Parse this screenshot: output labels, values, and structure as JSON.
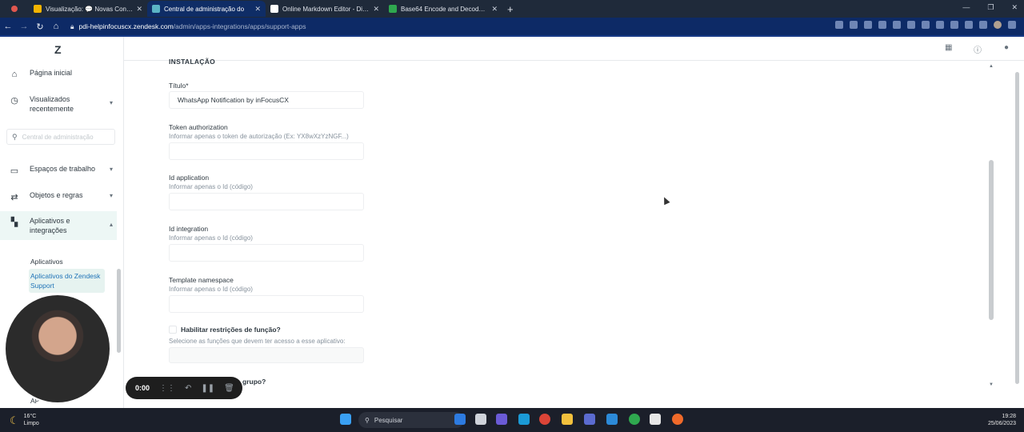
{
  "browser": {
    "tabs": [
      {
        "label": "Visualização: 💬 Novas Conversa",
        "color": "#f4b400",
        "active": false
      },
      {
        "label": "Central de administração do",
        "color": "#5ab4c5",
        "active": true
      },
      {
        "label": "Online Markdown Editor - Dilling",
        "color": "#ffffff",
        "active": false
      },
      {
        "label": "Base64 Encode and Decode - On",
        "color": "#2fa84f",
        "active": false
      }
    ],
    "url_host": "pdi-helpinfocuscx.zendesk.com",
    "url_path": "/admin/apps-integrations/apps/support-apps"
  },
  "sidebar": {
    "items": [
      {
        "label": "Página inicial",
        "icon": "home-icon"
      },
      {
        "label": "Visualizados recentemente",
        "icon": "clock-icon"
      },
      {
        "label": "Espaços de trabalho",
        "icon": "monitor-icon"
      },
      {
        "label": "Objetos e regras",
        "icon": "rules-icon"
      },
      {
        "label": "Aplicativos e integrações",
        "icon": "apps-icon"
      }
    ],
    "search_placeholder": "Central de administração",
    "sub_items": [
      "Aplicativos",
      "Aplicativos do Zendesk Support"
    ],
    "cut_item": "AP"
  },
  "form": {
    "section_title": "INSTALAÇÃO",
    "fields": [
      {
        "label": "Título*",
        "hint": "",
        "value": "WhatsApp Notification by inFocusCX"
      },
      {
        "label": "Token authorization",
        "hint": "Informar apenas o token de autorização (Ex: YX8wXzYzNGF...)",
        "value": ""
      },
      {
        "label": "Id application",
        "hint": "Informar apenas o Id (código)",
        "value": ""
      },
      {
        "label": "Id integration",
        "hint": "Informar apenas o Id (código)",
        "value": ""
      },
      {
        "label": "Template namespace",
        "hint": "Informar apenas o Id (código)",
        "value": ""
      }
    ],
    "role_check_label": "Habilitar restrições de função?",
    "role_hint": "Selecione as funções que devem ter acesso a esse aplicativo:",
    "group_check_label_partial": "grupo?"
  },
  "recorder": {
    "time": "0:00"
  },
  "taskbar": {
    "temp": "16°C",
    "condition": "Limpo",
    "search": "Pesquisar",
    "time": "19:28",
    "date": "25/06/2023"
  }
}
